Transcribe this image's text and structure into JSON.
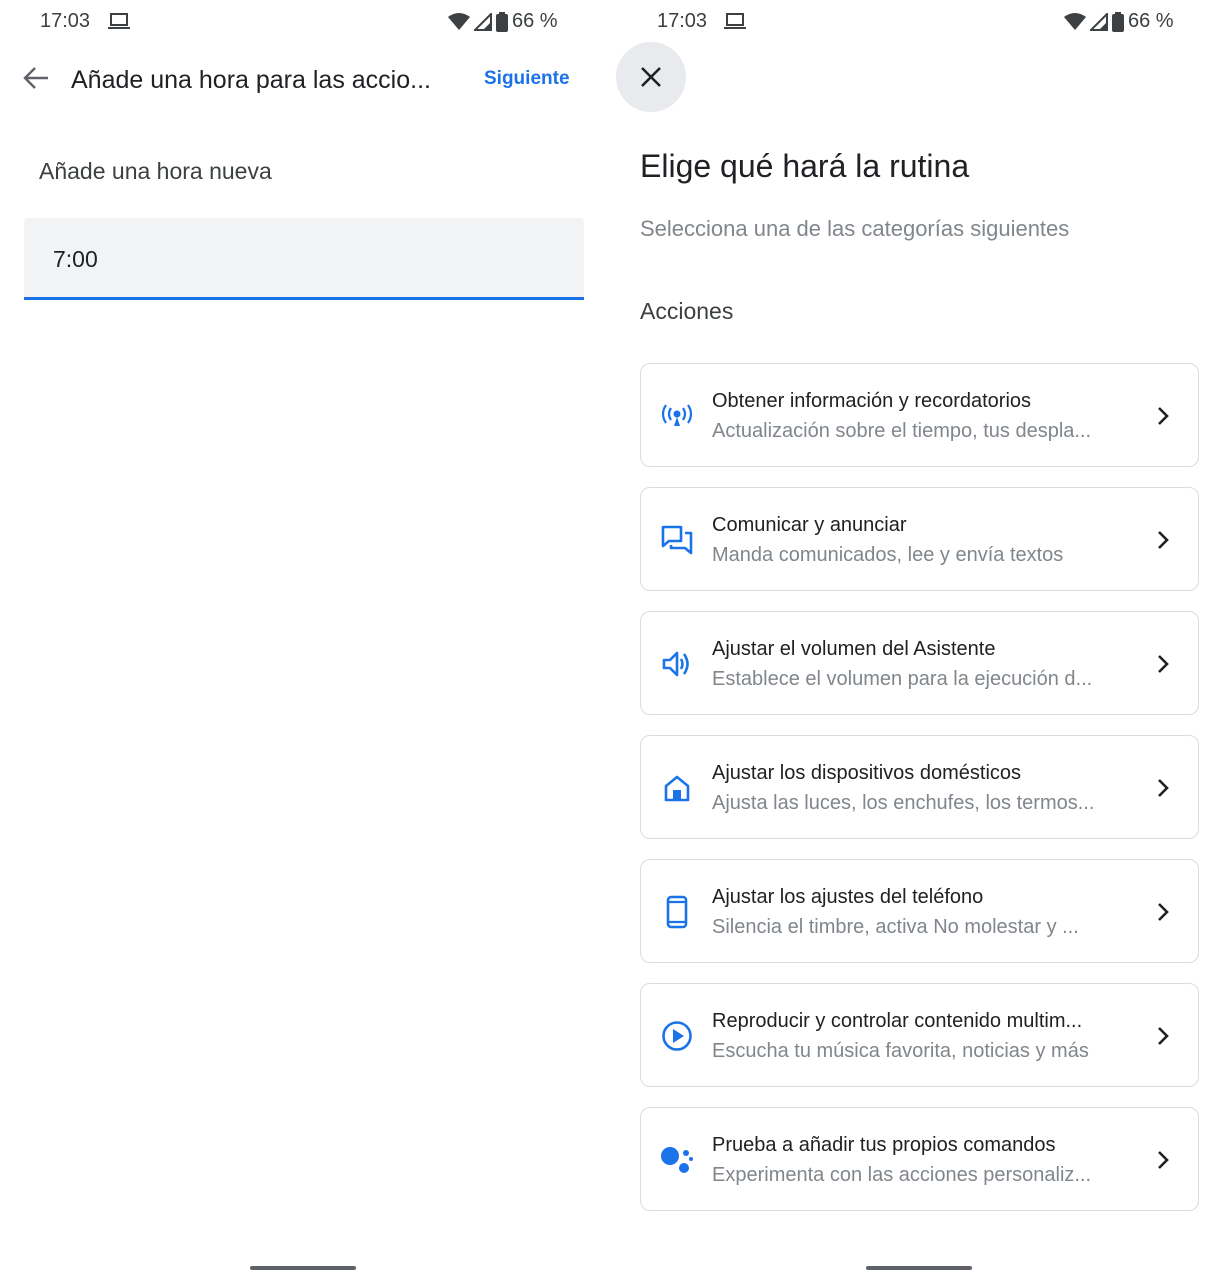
{
  "left_screen": {
    "status": {
      "time": "17:03",
      "battery": "66 %"
    },
    "toolbar": {
      "title": "Añade una hora para las accio...",
      "next_label": "Siguiente"
    },
    "section_label": "Añade una hora nueva",
    "time_field": {
      "value": "7:00"
    }
  },
  "right_screen": {
    "status": {
      "time": "17:03",
      "battery": "66 %"
    },
    "title": "Elige qué hará la rutina",
    "subtitle": "Selecciona una de las categorías siguientes",
    "section": "Acciones",
    "cards": [
      {
        "icon": "broadcast-icon",
        "title": "Obtener información y recordatorios",
        "subtitle": "Actualización sobre el tiempo, tus despla..."
      },
      {
        "icon": "chat-bubbles-icon",
        "title": "Comunicar y anunciar",
        "subtitle": "Manda comunicados, lee y envía textos"
      },
      {
        "icon": "volume-icon",
        "title": "Ajustar el volumen del Asistente",
        "subtitle": "Establece el volumen para la ejecución d..."
      },
      {
        "icon": "home-icon",
        "title": "Ajustar los dispositivos domésticos",
        "subtitle": "Ajusta las luces, los enchufes, los termos..."
      },
      {
        "icon": "phone-icon",
        "title": "Ajustar los ajustes del teléfono",
        "subtitle": "Silencia el timbre, activa No molestar y ..."
      },
      {
        "icon": "play-circle-icon",
        "title": "Reproducir y controlar contenido multim...",
        "subtitle": "Escucha tu música favorita, noticias y más"
      },
      {
        "icon": "assistant-icon",
        "title": "Prueba a añadir tus propios comandos",
        "subtitle": "Experimenta con las acciones personaliz..."
      }
    ]
  },
  "colors": {
    "accent": "#1a73e8",
    "text_primary": "#202124",
    "text_secondary": "#80868b",
    "field_bg": "#f1f3f4",
    "card_border": "#dadce0"
  }
}
